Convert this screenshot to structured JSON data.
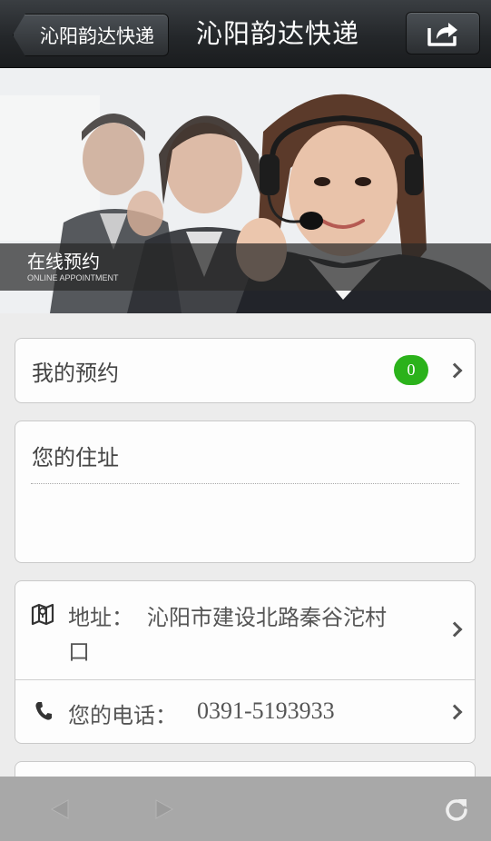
{
  "header": {
    "back_label": "沁阳韵达快递",
    "title": "沁阳韵达快递"
  },
  "banner": {
    "title": "在线预约",
    "subtitle": "ONLINE APPOINTMENT"
  },
  "my_appointments": {
    "label": "我的预约",
    "count": "0"
  },
  "address_input": {
    "label": "您的住址"
  },
  "contact": {
    "address_label": "地址：",
    "address_value_line1": "沁阳市建设北路秦谷沱村",
    "address_value_line2": "口",
    "phone_label": "您的电话：",
    "phone_value": "0391-5193933"
  },
  "colors": {
    "badge": "#2bb21b",
    "header": "#24272a",
    "bottom_bar": "#a8a8a8"
  },
  "icons": {
    "back": "back-arrow-icon",
    "share": "share-icon",
    "map": "map-icon",
    "phone": "phone-icon",
    "chevron": "chevron-right-icon",
    "nav_back": "nav-back-icon",
    "nav_forward": "nav-forward-icon",
    "refresh": "refresh-icon"
  }
}
